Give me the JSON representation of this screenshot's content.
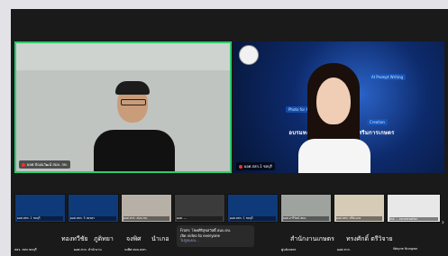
{
  "tiles": {
    "left_name": "ผอศ.ปัณณวัฒน์ สมบ. กษ.",
    "right_name": "ผอศ.สสก.1 ชลบุรี",
    "banner_title": "อบรมหลักสูตรการ...งานส่งเสริมการเกษตร",
    "banner_tags": [
      "AI Prompt Writing",
      "Photo for AI",
      "Creation"
    ]
  },
  "thumbs": [
    {
      "label": "ผอศ.สสก. 1 ชลบุรี"
    },
    {
      "label": "ผอศ.สสก. 5 สงขลา"
    },
    {
      "label": "ผอศ.สวก. สมบ.กษ."
    },
    {
      "label": "ผอศ. ..."
    },
    {
      "label": "ผอศ.สสก. 1 ชลบุรี"
    },
    {
      "label": "ผอศ.อารีรัตน์ สมบ."
    },
    {
      "label": "ผอศ.สสก. ศรีสะเกษ"
    },
    {
      "label": "Ask ... conversation"
    }
  ],
  "bottom_names": [
    "ทองทวีชัย",
    "ภูดิทยา",
    "จงพิศ",
    "นำเกอ",
    "สำนักงานเกษตร",
    "ทรงศักดิ์ ตรีวิจาย",
    "อ. ..."
  ],
  "bottom_labels": [
    "สสจ. สสก.ชลบุรี",
    "ผอศ.สวก. สำนักงาน",
    "จงพิศ สมบ.สสก.",
    "ศูนย์เกษตร",
    "ผอศ.สวก.",
    "Wayne Nungwn"
  ],
  "toast": {
    "from": "From: โชคศิริสุขสวัสดิ์ สมบ.กษ.",
    "to": "เปิด video to everyone",
    "sub": "ไปรูปแบบ..."
  }
}
